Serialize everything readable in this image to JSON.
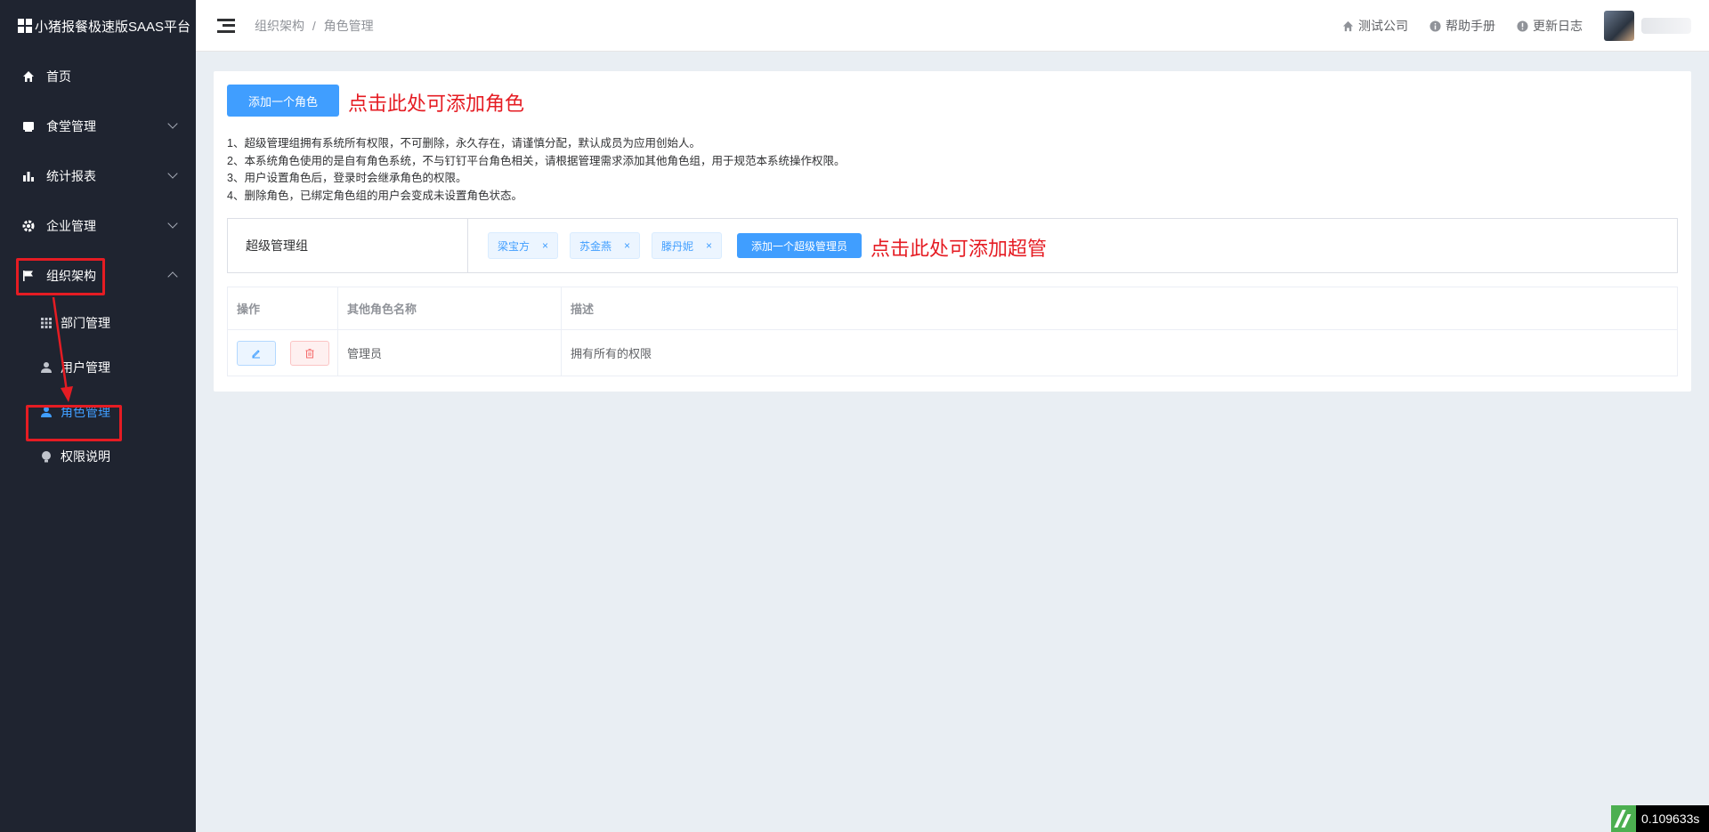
{
  "app": {
    "title": "小猪报餐极速版SAAS平台"
  },
  "sidebar": {
    "items": [
      {
        "label": "首页",
        "icon": "home-icon"
      },
      {
        "label": "食堂管理",
        "icon": "canteen-icon"
      },
      {
        "label": "统计报表",
        "icon": "bar-chart-icon"
      },
      {
        "label": "企业管理",
        "icon": "gear-icon"
      },
      {
        "label": "组织架构",
        "icon": "flag-icon"
      }
    ],
    "sub_items": [
      {
        "label": "部门管理",
        "icon": "grid-icon"
      },
      {
        "label": "用户管理",
        "icon": "user-icon"
      },
      {
        "label": "角色管理",
        "icon": "user-icon"
      },
      {
        "label": "权限说明",
        "icon": "bulb-icon"
      }
    ]
  },
  "header": {
    "breadcrumb": [
      "组织架构",
      "角色管理"
    ],
    "breadcrumb_sep": "/",
    "links": [
      {
        "label": "测试公司",
        "icon": "home-icon"
      },
      {
        "label": "帮助手册",
        "icon": "info-icon"
      },
      {
        "label": "更新日志",
        "icon": "alert-icon"
      }
    ]
  },
  "main": {
    "add_role_button": "添加一个角色",
    "add_role_note": "点击此处可添加角色",
    "notes": [
      "1、超级管理组拥有系统所有权限，不可删除，永久存在，请谨慎分配，默认成员为应用创始人。",
      "2、本系统角色使用的是自有角色系统，不与钉钉平台角色相关，请根据管理需求添加其他角色组，用于规范本系统操作权限。",
      "3、用户设置角色后，登录时会继承角色的权限。",
      "4、删除角色，已绑定角色组的用户会变成未设置角色状态。"
    ],
    "super_group": {
      "label": "超级管理组",
      "members": [
        "梁宝方",
        "苏金燕",
        "滕丹妮"
      ],
      "tag_close": "×",
      "add_button": "添加一个超级管理员",
      "add_note": "点击此处可添加超管"
    },
    "table": {
      "headers": [
        "操作",
        "其他角色名称",
        "描述"
      ],
      "rows": [
        {
          "name": "管理员",
          "description": "拥有所有的权限"
        }
      ]
    }
  },
  "timer": "0.109633s",
  "colors": {
    "sidebar_bg": "#1f2430",
    "primary": "#409eff",
    "annotation_red": "#e51c23"
  }
}
